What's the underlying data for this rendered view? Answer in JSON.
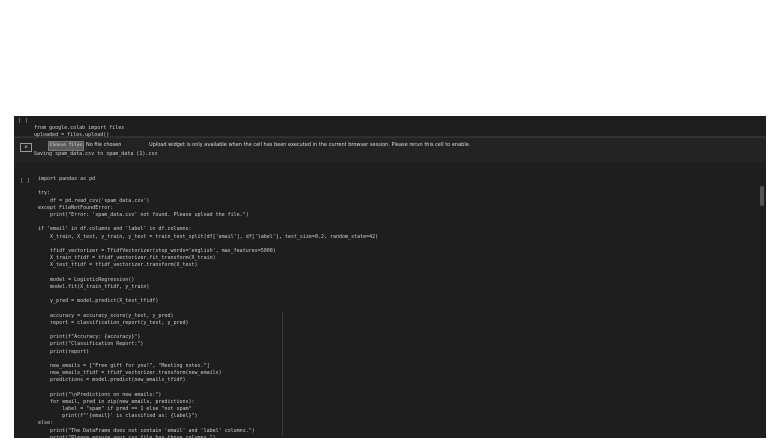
{
  "cell1": {
    "gutter": "[ ]",
    "lines": [
      "from google.colab import files",
      "uploaded = files.upload()"
    ]
  },
  "output": {
    "choose_button": "Choose files",
    "no_file": "No file chosen",
    "note": "Upload widget is only available when the cell has been executed in the current browser session. Please rerun this cell to enable.",
    "saving": "Saving spam_data.csv to spam_data (1).csv"
  },
  "cell2": {
    "gutter": "[ ]",
    "lines": [
      "import pandas as pd",
      "",
      "try:",
      "    df = pd.read_csv('spam_data.csv')",
      "except FileNotFoundError:",
      "    print(\"Error: 'spam_data.csv' not found. Please upload the file.\")",
      "",
      "if 'email' in df.columns and 'label' in df.columns:",
      "    X_train, X_test, y_train, y_test = train_test_split(df['email'], df['label'], test_size=0.2, random_state=42)",
      "",
      "    tfidf_vectorizer = TfidfVectorizer(stop_words='english', max_features=5000)",
      "    X_train_tfidf = tfidf_vectorizer.fit_transform(X_train)",
      "    X_test_tfidf = tfidf_vectorizer.transform(X_test)",
      "",
      "    model = LogisticRegression()",
      "    model.fit(X_train_tfidf, y_train)",
      "",
      "    y_pred = model.predict(X_test_tfidf)",
      "",
      "    accuracy = accuracy_score(y_test, y_pred)",
      "    report = classification_report(y_test, y_pred)",
      "",
      "    print(f\"Accuracy: {accuracy}\")",
      "    print(\"Classification Report:\")",
      "    print(report)",
      "",
      "    new_emails = [\"Free gift for you!\", \"Meeting notes.\"]",
      "    new_emails_tfidf = tfidf_vectorizer.transform(new_emails)",
      "    predictions = model.predict(new_emails_tfidf)",
      "",
      "    print(\"\\nPredictions on new emails:\")",
      "    for email, pred in zip(new_emails, predictions):",
      "        label = \"spam\" if pred == 1 else \"not spam\"",
      "        print(f\"'{email}' is classified as: {label}\")",
      "else:",
      "    print(\"The DataFrame does not contain 'email' and 'label' columns.\")",
      "    print(\"Please ensure your csv file has those columns.\")"
    ]
  }
}
